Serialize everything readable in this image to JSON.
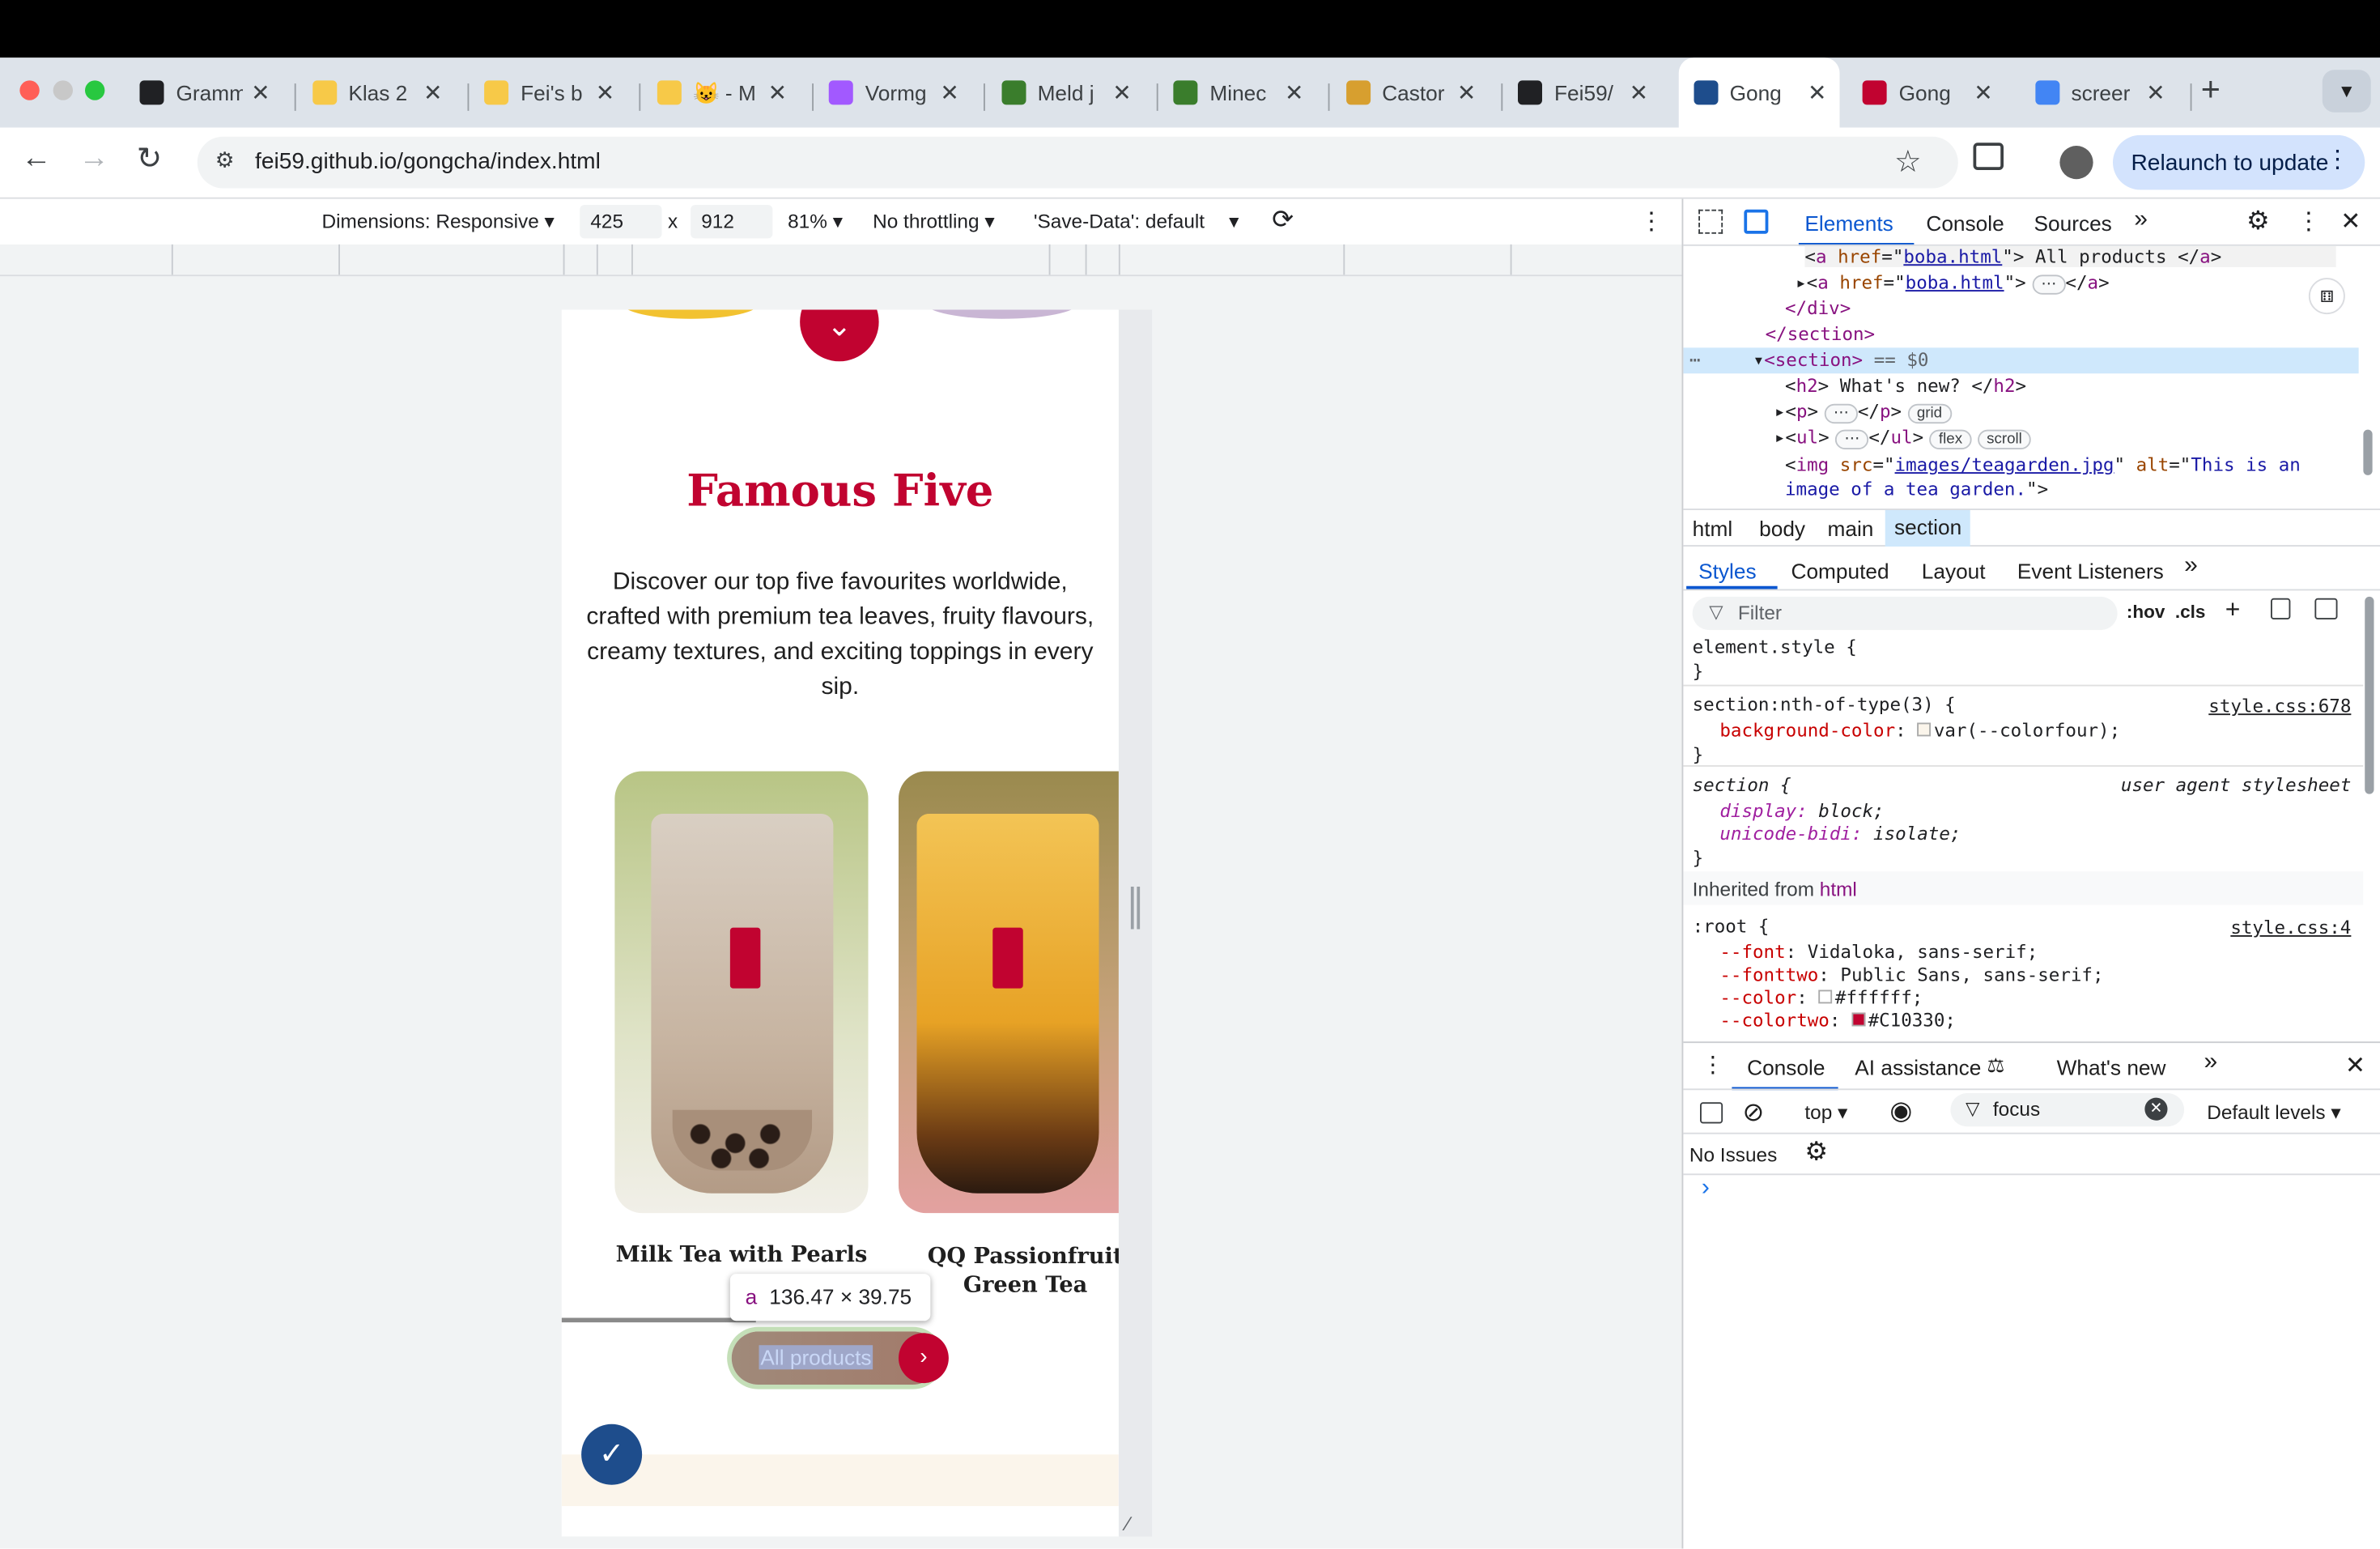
{
  "browser": {
    "tabs": [
      {
        "title": "Gramm",
        "color": "#202124"
      },
      {
        "title": "Klas 2",
        "color": "#f7c948"
      },
      {
        "title": "Fei's b",
        "color": "#f7c948"
      },
      {
        "title": "😺 - M",
        "color": "#f7c948"
      },
      {
        "title": "Vormg",
        "color": "#a259ff"
      },
      {
        "title": "Meld j",
        "color": "#3a7d2c"
      },
      {
        "title": "Minec",
        "color": "#3a7d2c"
      },
      {
        "title": "Castor",
        "color": "#d79f2f"
      },
      {
        "title": "Fei59/",
        "color": "#202124"
      },
      {
        "title": "Gong",
        "color": "#1e4d8c"
      },
      {
        "title": "Gong",
        "color": "#c10330"
      },
      {
        "title": "screer",
        "color": "#4285f4"
      }
    ],
    "url": "fei59.github.io/gongcha/index.html",
    "relaunch_label": "Relaunch to update"
  },
  "device_toolbar": {
    "dimensions": "Dimensions: Responsive",
    "width": "425",
    "times": "x",
    "height": "912",
    "zoom": "81%",
    "throttling": "No throttling",
    "save_data": "'Save-Data': default"
  },
  "page": {
    "heading": "Famous Five",
    "description": "Discover our top five favourites worldwide, crafted with premium tea leaves, fruity flavours, creamy textures, and exciting toppings in every sip.",
    "products": [
      {
        "name": "Milk Tea with Pearls"
      },
      {
        "name": "QQ Passionfruit Green Tea"
      }
    ],
    "button_label": "All products",
    "tooltip_tag": "a",
    "tooltip_size": "136.47 × 39.75",
    "colors": {
      "primary": "#C10330",
      "cream": "#fbf5eb"
    }
  },
  "devtools": {
    "tabs": [
      "Elements",
      "Console",
      "Sources"
    ],
    "dom": {
      "line1_href": "boba.html",
      "line1_text": " All products ",
      "line2_href": "boba.html",
      "div_close": "</div>",
      "section_close": "</section>",
      "section_open": "<section>",
      "section_eq": "== $0",
      "h2_text": " What's new? ",
      "img_src": "images/teagarden.jpg",
      "img_alt": "This is an image of a tea garden."
    },
    "badges": {
      "grid": "grid",
      "flex": "flex",
      "scroll": "scroll"
    },
    "breadcrumb": [
      "html",
      "body",
      "main",
      "section"
    ],
    "style_tabs": [
      "Styles",
      "Computed",
      "Layout",
      "Event Listeners"
    ],
    "filter_placeholder": "Filter",
    "hov": ":hov",
    "cls": ".cls",
    "rules": {
      "element_style": "element.style {",
      "r1_selector": "section:nth-of-type(3) {",
      "r1_source": "style.css:678",
      "r1_prop": "background-color",
      "r1_value": "var(--colorfour);",
      "r2_selector": "section {",
      "r2_source": "user agent stylesheet",
      "r2_p1": "display",
      "r2_v1": "block;",
      "r2_p2": "unicode-bidi",
      "r2_v2": "isolate;",
      "inherited": "Inherited from",
      "inherited_el": "html",
      "r3_selector": ":root {",
      "r3_source": "style.css:4",
      "vars": [
        {
          "name": "--font",
          "value": "Vidaloka, sans-serif;"
        },
        {
          "name": "--fonttwo",
          "value": "Public Sans, sans-serif;"
        },
        {
          "name": "--color",
          "value": "#ffffff;"
        },
        {
          "name": "--colortwo",
          "value": "#C10330;"
        }
      ]
    },
    "drawer": {
      "tabs": [
        "Console",
        "AI assistance",
        "What's new"
      ],
      "context": "top",
      "filter_value": "focus",
      "levels": "Default levels",
      "issues": "No Issues"
    }
  }
}
